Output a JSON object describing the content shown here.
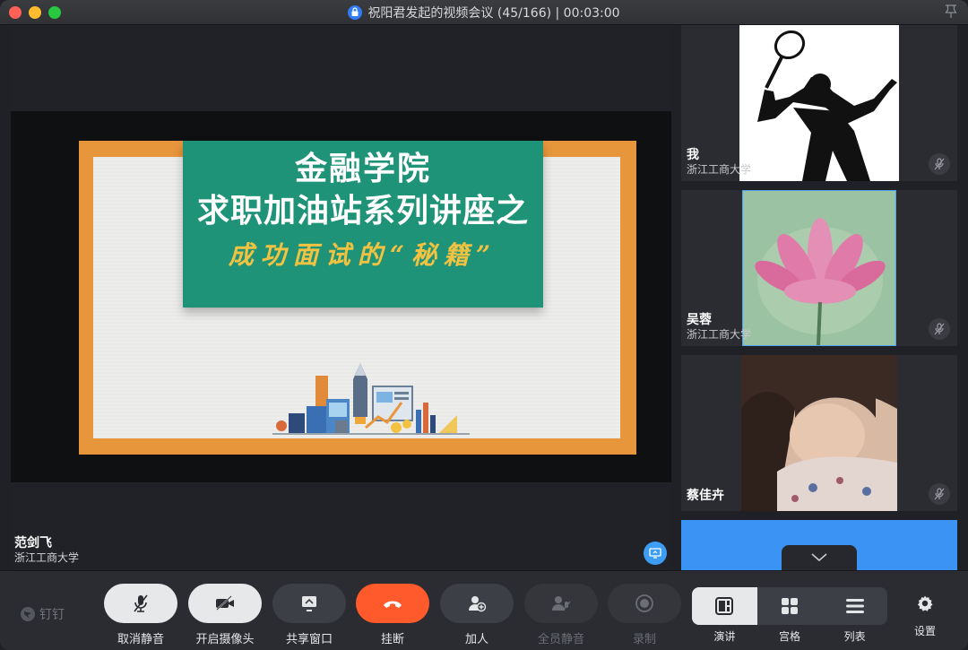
{
  "window": {
    "title": "祝阳君发起的视频会议 (45/166) | 00:03:00"
  },
  "slide": {
    "line1": "金融学院",
    "line2": "求职加油站系列讲座之",
    "line3": "成功面试的“秘籍”"
  },
  "speaker": {
    "name": "范剑飞",
    "org": "浙江工商大学"
  },
  "participants": [
    {
      "name": "我",
      "org": "浙江工商大学",
      "avatar": "badminton-silhouette"
    },
    {
      "name": "吴蓉",
      "org": "浙江工商大学",
      "avatar": "lotus-painting"
    },
    {
      "name": "蔡佳卉",
      "org": "",
      "avatar": "person-photo"
    }
  ],
  "toolbar": {
    "brand": "钉钉",
    "mute_label": "取消静音",
    "camera_label": "开启摄像头",
    "share_label": "共享窗口",
    "hangup_label": "挂断",
    "add_label": "加人",
    "mute_all_label": "全员静音",
    "record_label": "录制",
    "layouts": [
      "演讲",
      "宫格",
      "列表"
    ],
    "settings_label": "设置"
  },
  "colors": {
    "accent": "#3b93f3",
    "hangup": "#ff5a2b",
    "slide_frame": "#e8963c",
    "slide_banner": "#1f9377",
    "slide_subtitle": "#f2c242"
  }
}
